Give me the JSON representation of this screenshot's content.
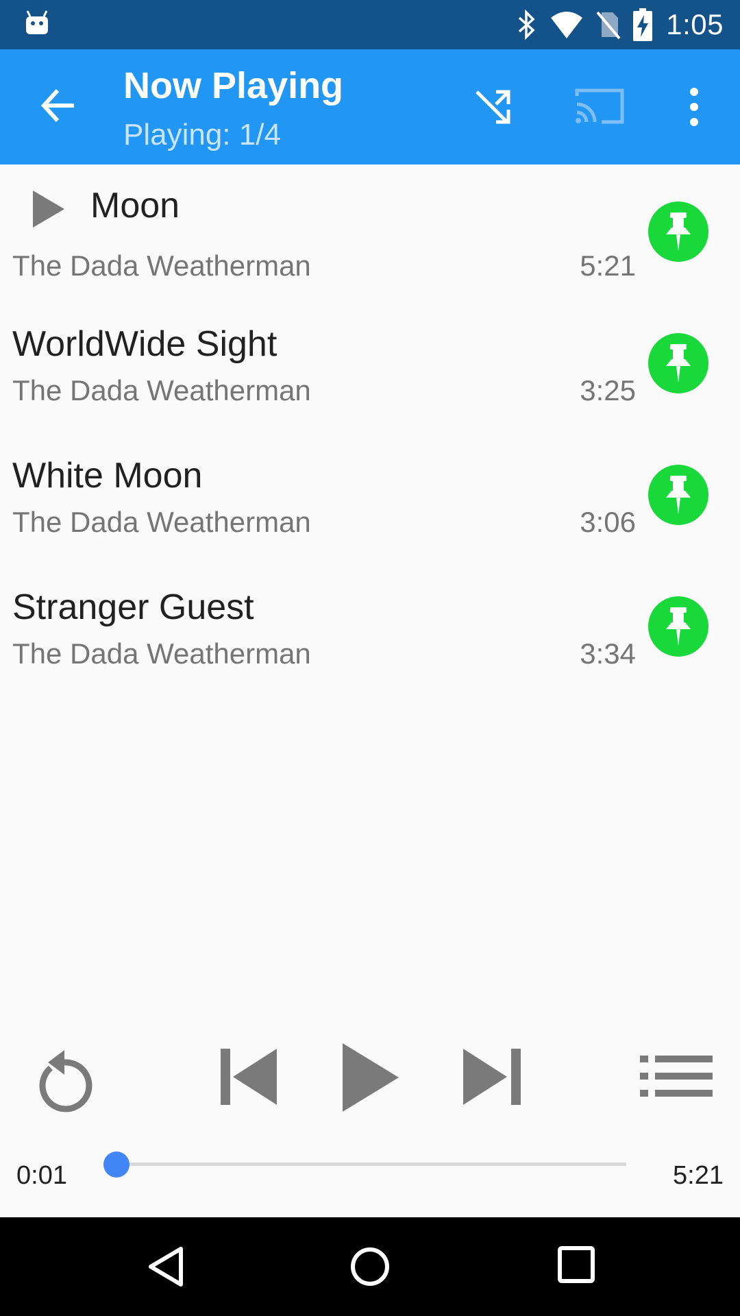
{
  "status_bar": {
    "time": "1:05",
    "icons": [
      "android-debug-icon",
      "bluetooth-icon",
      "wifi-icon",
      "no-sim-icon",
      "battery-charging-icon"
    ]
  },
  "app_bar": {
    "title": "Now Playing",
    "subtitle": "Playing: 1/4",
    "icons": [
      "back-arrow-icon",
      "shuffle-icon",
      "cast-icon",
      "more-vert-icon"
    ]
  },
  "tracks": [
    {
      "title": "Moon",
      "artist": "The Dada Weatherman",
      "duration": "5:21",
      "playing": true
    },
    {
      "title": "WorldWide Sight",
      "artist": "The Dada Weatherman",
      "duration": "3:25",
      "playing": false
    },
    {
      "title": "White Moon",
      "artist": "The Dada Weatherman",
      "duration": "3:06",
      "playing": false
    },
    {
      "title": "Stranger Guest",
      "artist": "The Dada Weatherman",
      "duration": "3:34",
      "playing": false
    }
  ],
  "controls": {
    "icons": [
      "repeat-icon",
      "skip-previous-icon",
      "play-icon",
      "skip-next-icon",
      "queue-list-icon"
    ]
  },
  "seek": {
    "current": "0:01",
    "total": "5:21",
    "progress": 0.003
  },
  "nav_bar": {
    "icons": [
      "back-nav-icon",
      "home-nav-icon",
      "recents-nav-icon"
    ]
  },
  "colors": {
    "status_bar": "#14528a",
    "app_bar": "#2196f3",
    "pin": "#19d83a",
    "accent": "#4285f4"
  }
}
